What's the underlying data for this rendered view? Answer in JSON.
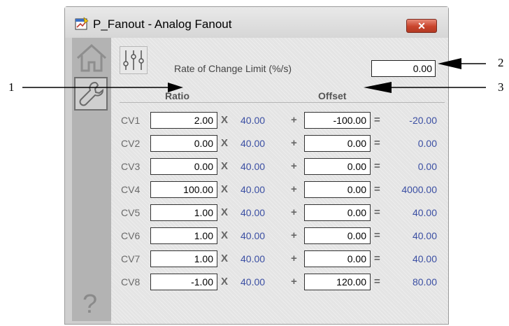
{
  "window": {
    "title": "P_Fanout - Analog Fanout",
    "close_label": "✕"
  },
  "sidebar": {
    "items": [
      {
        "name": "home",
        "icon": "home-icon"
      },
      {
        "name": "maintenance",
        "icon": "wrench-icon"
      },
      {
        "name": "help",
        "icon": "help-icon",
        "glyph": "?"
      }
    ]
  },
  "settings": {
    "roc_label": "Rate of Change Limit (%/s)",
    "roc_value": "0.00"
  },
  "table": {
    "headers": {
      "ratio": "Ratio",
      "offset": "Offset"
    },
    "operators": {
      "times": "X",
      "plus": "+",
      "equals": "="
    },
    "rows": [
      {
        "cv": "CV1",
        "ratio": "2.00",
        "pv": "40.00",
        "offset": "-100.00",
        "result": "-20.00"
      },
      {
        "cv": "CV2",
        "ratio": "0.00",
        "pv": "40.00",
        "offset": "0.00",
        "result": "0.00"
      },
      {
        "cv": "CV3",
        "ratio": "0.00",
        "pv": "40.00",
        "offset": "0.00",
        "result": "0.00"
      },
      {
        "cv": "CV4",
        "ratio": "100.00",
        "pv": "40.00",
        "offset": "0.00",
        "result": "4000.00"
      },
      {
        "cv": "CV5",
        "ratio": "1.00",
        "pv": "40.00",
        "offset": "0.00",
        "result": "40.00"
      },
      {
        "cv": "CV6",
        "ratio": "1.00",
        "pv": "40.00",
        "offset": "0.00",
        "result": "40.00"
      },
      {
        "cv": "CV7",
        "ratio": "1.00",
        "pv": "40.00",
        "offset": "0.00",
        "result": "40.00"
      },
      {
        "cv": "CV8",
        "ratio": "-1.00",
        "pv": "40.00",
        "offset": "120.00",
        "result": "80.00"
      }
    ]
  },
  "annotations": {
    "one": "1",
    "two": "2",
    "three": "3"
  },
  "colors": {
    "value_blue": "#3b4fa3",
    "close_red": "#c9442c"
  }
}
